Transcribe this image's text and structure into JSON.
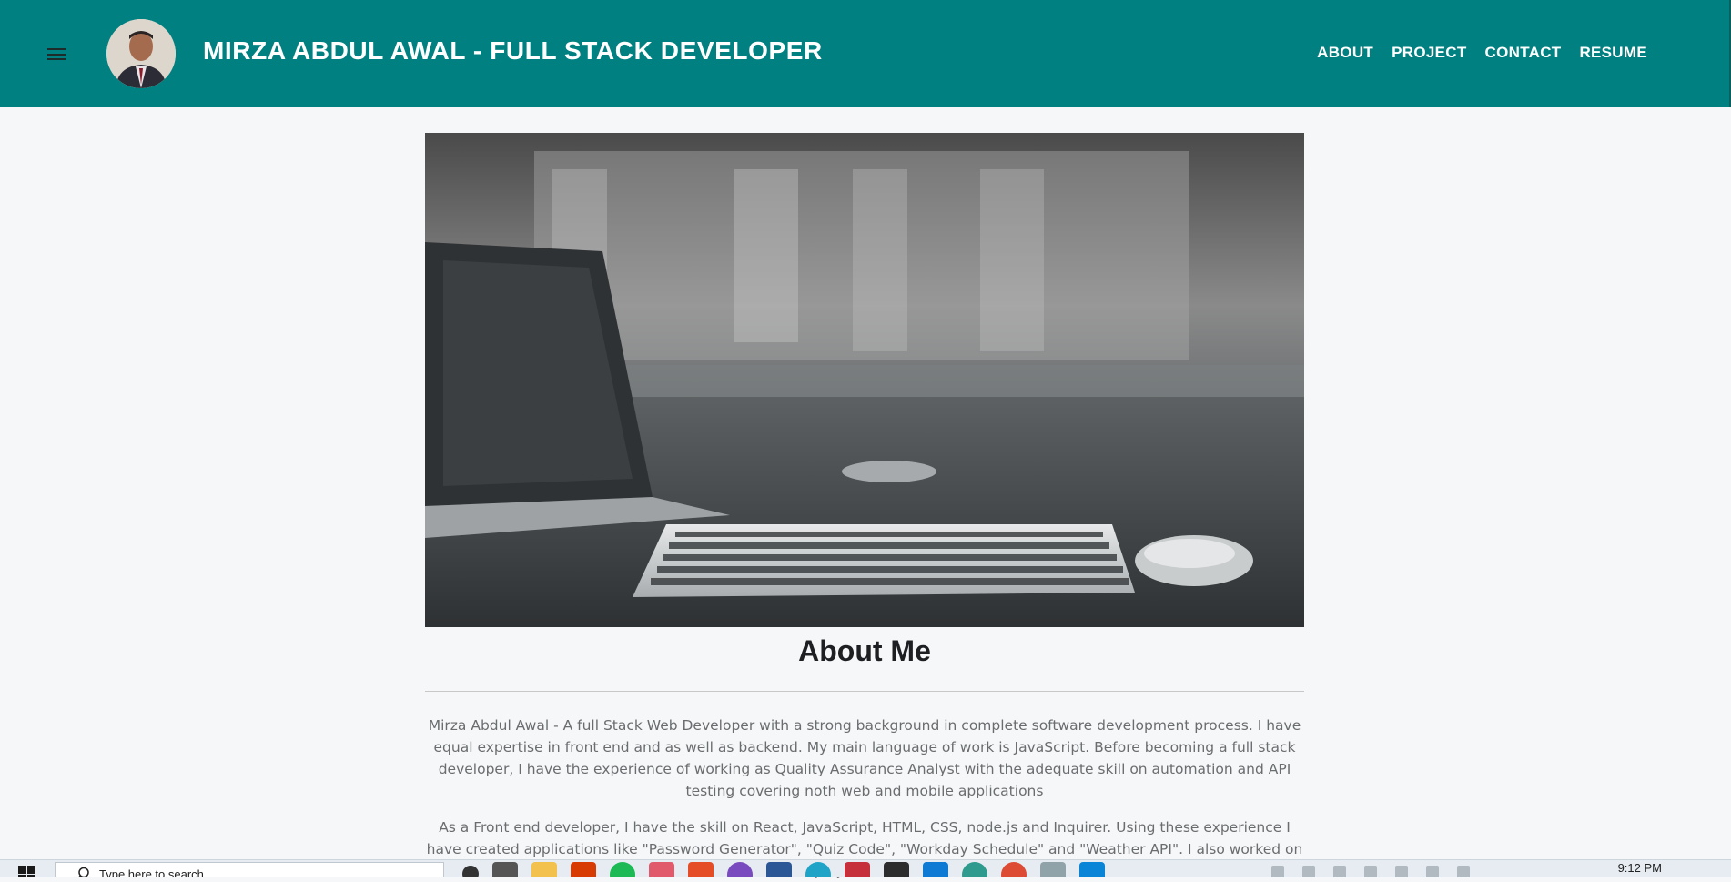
{
  "header": {
    "brand": "MIRZA ABDUL AWAL - FULL STACK DEVELOPER",
    "menu_icon": "hamburger-menu-icon",
    "avatar_icon": "profile-photo",
    "nav": [
      {
        "label": "ABOUT"
      },
      {
        "label": "PROJECT"
      },
      {
        "label": "CONTACT"
      },
      {
        "label": "RESUME"
      }
    ],
    "background_color": "#008080"
  },
  "main": {
    "hero_image": "desk-keyboard-mouse-laptop-photo",
    "about_title": "About Me",
    "paragraphs": [
      "Mirza Abdul Awal - A full Stack Web Developer with a strong background in complete software development process. I have equal expertise in front end and as well as backend. My main language of work is JavaScript. Before becoming a full stack developer, I have the experience of working as Quality Assurance Analyst with the adequate skill on automation and API testing covering noth web and mobile applications",
      "As a Front end developer, I have the skill on React, JavaScript, HTML, CSS, node.js and Inquirer. Using these experience I have created applications like \"Password Generator\", \"Quiz Code\", \"Workday Schedule\" and \"Weather API\". I also worked on a project \"Kukoo's"
    ]
  },
  "taskbar": {
    "search_placeholder": "Type here to search",
    "clock": "9:12 PM",
    "icons": [
      "windows-start-icon",
      "search-icon",
      "cortana-icon",
      "task-view-icon",
      "file-explorer-icon",
      "office-icon",
      "spotify-icon",
      "app-icon",
      "html-icon",
      "app-icon",
      "app-icon",
      "edge-icon",
      "mail-icon",
      "terminal-icon",
      "vscode-icon",
      "app-icon",
      "chrome-icon",
      "app-icon",
      "info-icon"
    ]
  }
}
